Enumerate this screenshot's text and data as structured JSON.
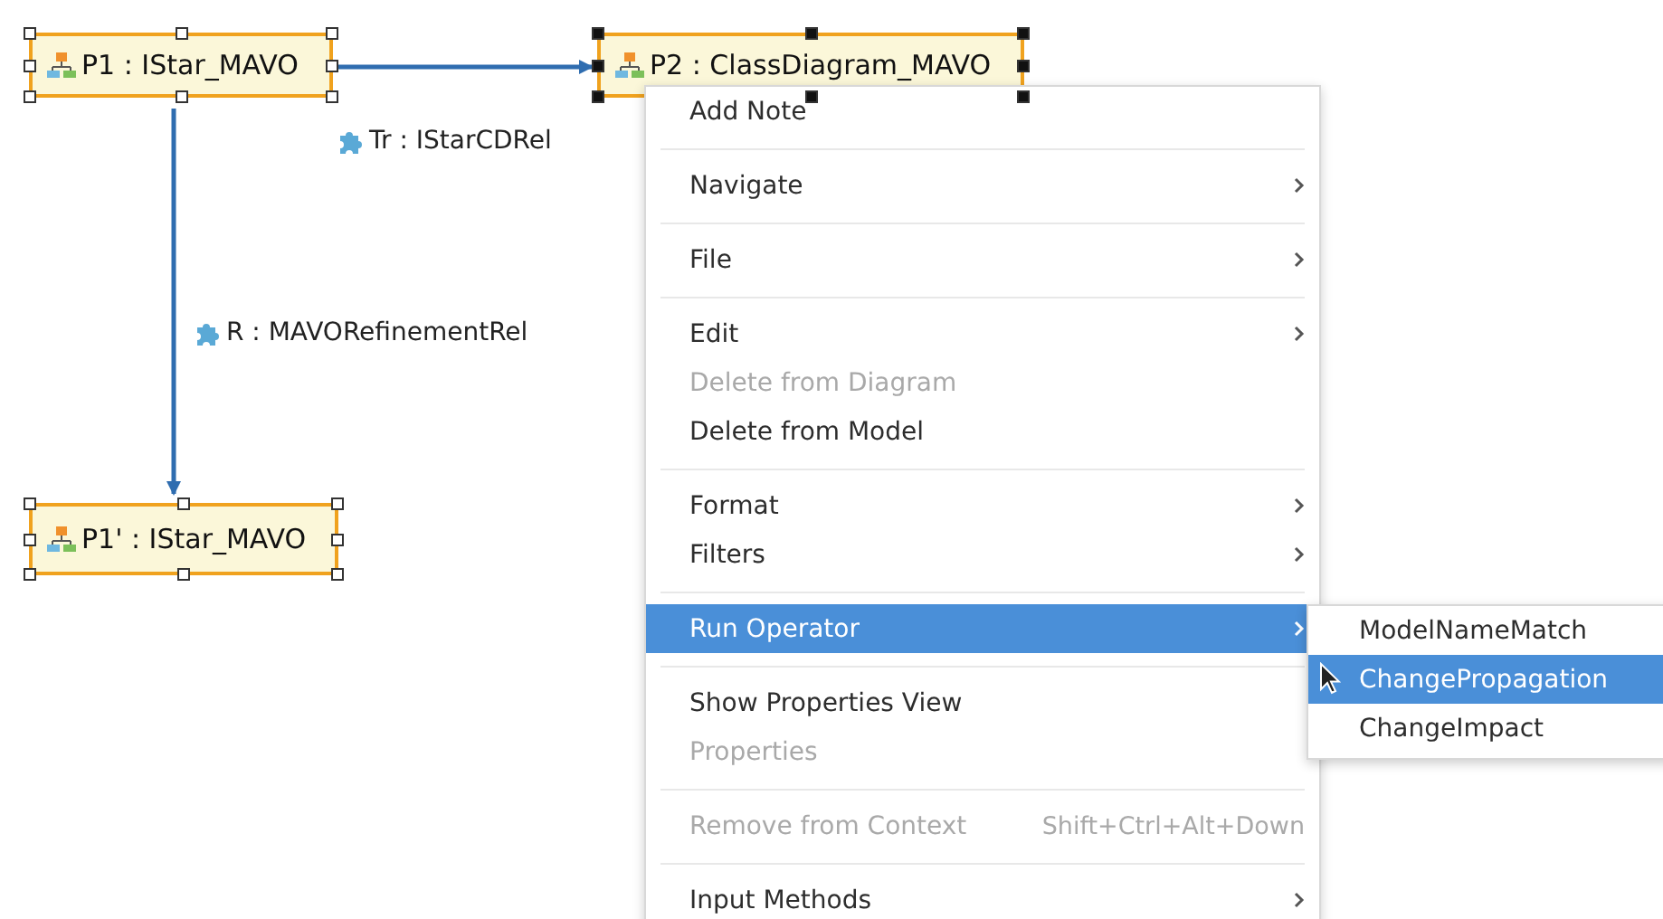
{
  "diagram": {
    "nodes": [
      {
        "label": "P1 : IStar_MAVO",
        "selected": true,
        "primary": false
      },
      {
        "label": "P2 : ClassDiagram_MAVO",
        "selected": true,
        "primary": true
      },
      {
        "label": "P1' : IStar_MAVO",
        "selected": true,
        "primary": false
      }
    ],
    "edges": [
      {
        "label": "Tr : IStarCDRel",
        "kind": "horizontal"
      },
      {
        "label": "R : MAVORefinementRel",
        "kind": "vertical"
      }
    ]
  },
  "context_menu": {
    "groups": [
      [
        {
          "label": "Add Note",
          "disabled": false,
          "submenu": false,
          "selected": false
        }
      ],
      [
        {
          "label": "Navigate",
          "disabled": false,
          "submenu": true,
          "selected": false
        }
      ],
      [
        {
          "label": "File",
          "disabled": false,
          "submenu": true,
          "selected": false
        }
      ],
      [
        {
          "label": "Edit",
          "disabled": false,
          "submenu": true,
          "selected": false
        },
        {
          "label": "Delete from Diagram",
          "disabled": true,
          "submenu": false,
          "selected": false
        },
        {
          "label": "Delete from Model",
          "disabled": false,
          "submenu": false,
          "selected": false
        }
      ],
      [
        {
          "label": "Format",
          "disabled": false,
          "submenu": true,
          "selected": false
        },
        {
          "label": "Filters",
          "disabled": false,
          "submenu": true,
          "selected": false
        }
      ],
      [
        {
          "label": "Run Operator",
          "disabled": false,
          "submenu": true,
          "selected": true
        }
      ],
      [
        {
          "label": "Show Properties View",
          "disabled": false,
          "submenu": false,
          "selected": false
        },
        {
          "label": "Properties",
          "disabled": true,
          "submenu": false,
          "selected": false
        }
      ],
      [
        {
          "label": "Remove from Context",
          "disabled": true,
          "submenu": false,
          "selected": false,
          "shortcut": "Shift+Ctrl+Alt+Down"
        }
      ],
      [
        {
          "label": "Input Methods",
          "disabled": false,
          "submenu": true,
          "selected": false
        }
      ]
    ]
  },
  "submenu": {
    "items": [
      {
        "label": "ModelNameMatch",
        "selected": false
      },
      {
        "label": "ChangePropagation",
        "selected": true
      },
      {
        "label": "ChangeImpact",
        "selected": false
      }
    ]
  }
}
